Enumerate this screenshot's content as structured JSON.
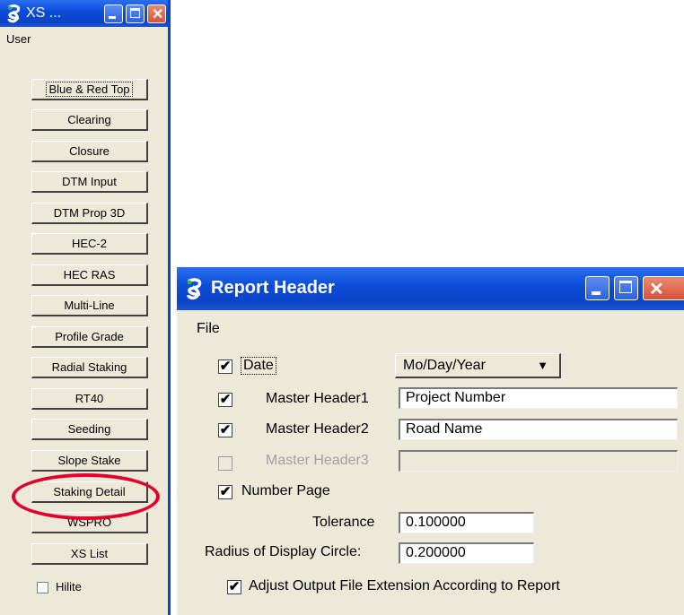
{
  "xs_window": {
    "title": "XS ...",
    "menu": [
      "User"
    ],
    "buttons": [
      "Blue & Red Top",
      "Clearing",
      "Closure",
      "DTM Input",
      "DTM Prop 3D",
      "HEC-2",
      "HEC RAS",
      "Multi-Line",
      "Profile Grade",
      "Radial Staking",
      "RT40",
      "Seeding",
      "Slope Stake",
      "Staking Detail",
      "WSPRO",
      "XS List"
    ],
    "hilite": {
      "label": "Hilite",
      "checked": false
    }
  },
  "report_header": {
    "title": "Report Header",
    "menu": [
      "File"
    ],
    "date": {
      "label": "Date",
      "checked": true,
      "format": "Mo/Day/Year"
    },
    "master_header1": {
      "label": "Master Header1",
      "checked": true,
      "value": "Project Number"
    },
    "master_header2": {
      "label": "Master Header2",
      "checked": true,
      "value": "Road Name"
    },
    "master_header3": {
      "label": "Master Header3",
      "checked": false,
      "value": ""
    },
    "number_page": {
      "label": "Number Page",
      "checked": true
    },
    "tolerance": {
      "label": "Tolerance",
      "value": "0.100000"
    },
    "radius": {
      "label": "Radius of Display Circle:",
      "value": "0.200000"
    },
    "adjust_ext": {
      "label": "Adjust Output File Extension According to Report",
      "checked": true
    }
  },
  "check_glyph": "✔",
  "annotation_color": "#e3002b"
}
